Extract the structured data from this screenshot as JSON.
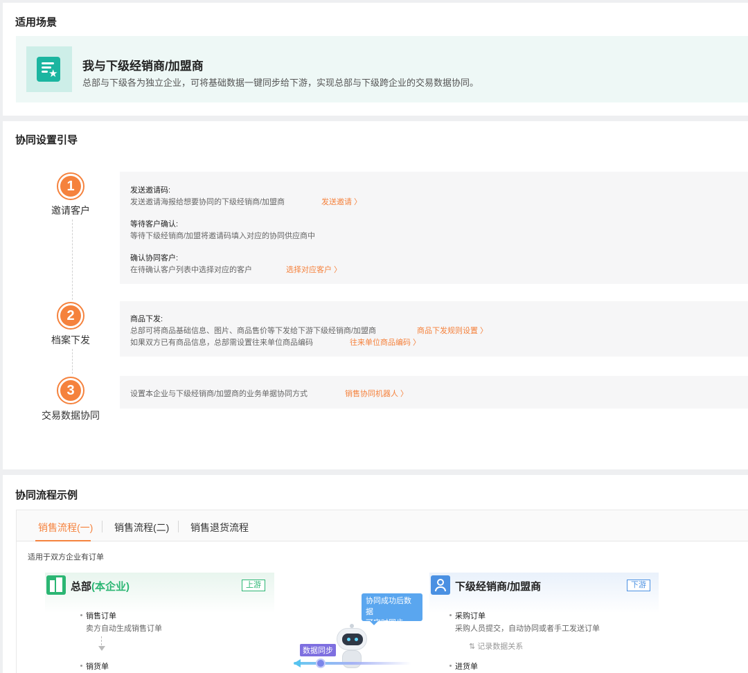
{
  "scene": {
    "section_title": "适用场景",
    "icon": "doc-star-icon",
    "name": "我与下级经销商/加盟商",
    "desc": "总部与下级各为独立企业，可将基础数据一键同步给下游，实现总部与下级跨企业的交易数据协同。"
  },
  "guide": {
    "section_title": "协同设置引导",
    "steps": [
      {
        "num": "1",
        "label": "邀请客户",
        "items": [
          {
            "title": "发送邀请码:",
            "desc": "发送邀请海报给想要协同的下级经销商/加盟商",
            "link": "发送邀请 〉"
          },
          {
            "title": "等待客户确认:",
            "desc": "等待下级经销商/加盟将邀请码填入对应的协同供应商中"
          },
          {
            "title": "确认协同客户:",
            "desc": "在待确认客户列表中选择对应的客户",
            "link": "选择对应客户 〉"
          }
        ]
      },
      {
        "num": "2",
        "label": "档案下发",
        "title": "商品下发:",
        "desc1": "总部可将商品基础信息、图片、商品售价等下发给下游下级经销商/加盟商",
        "link1": "商品下发规则设置 〉",
        "desc2": "如果双方已有商品信息，总部需设置往来单位商品编码",
        "link2": "往来单位商品编码 〉"
      },
      {
        "num": "3",
        "label": "交易数据协同",
        "desc": "设置本企业与下级经销商/加盟商的业务单据协同方式",
        "link": "销售协同机器人 〉"
      }
    ]
  },
  "flow": {
    "section_title": "协同流程示例",
    "tabs": [
      "销售流程(一)",
      "销售流程(二)",
      "销售退货流程"
    ],
    "note": "适用于双方企业有订单",
    "hq": {
      "title": "总部",
      "title_hl": "(本企业)",
      "badge": "上游",
      "docs": [
        {
          "name": "销售订单",
          "desc": "卖方自动生成销售订单"
        },
        {
          "name": "销货单"
        }
      ]
    },
    "ds": {
      "title": "下级经销商/加盟商",
      "badge": "下游",
      "docs": [
        {
          "name": "采购订单",
          "desc": "采购人员提交，自动协同或者手工发送订单"
        },
        {
          "name": "进货单"
        }
      ],
      "relation": "记录数据关系"
    },
    "bubble_line1": "协同成功后数据",
    "bubble_line2": "可实时同步",
    "sync_label": "数据同步"
  },
  "colors": {
    "accent": "#f5823d",
    "teal": "#1bb5a0",
    "green": "#2bb673",
    "blue": "#4a90e2"
  }
}
